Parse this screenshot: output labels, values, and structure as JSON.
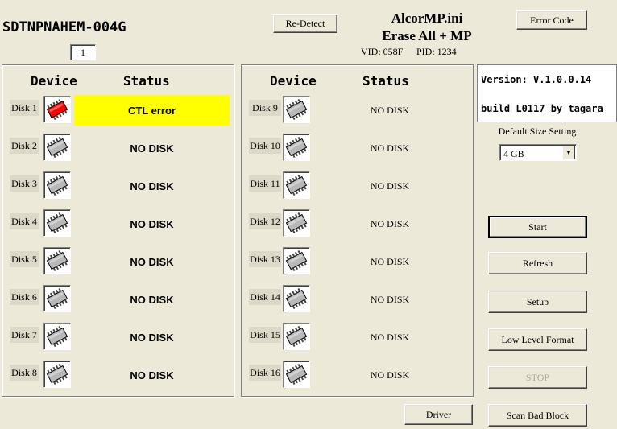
{
  "header": {
    "device_model": "SDTNPNAHEM-004G",
    "count_value": "1",
    "redetect_label": "Re-Detect",
    "ini_name": "AlcorMP.ini",
    "mode": "Erase All + MP",
    "vid": "VID: 058F",
    "pid": "PID: 1234",
    "error_code_label": "Error Code"
  },
  "panels": {
    "device_header": "Device",
    "status_header": "Status"
  },
  "left_disks": [
    {
      "label": "Disk 1",
      "status": "CTL error",
      "state": "error"
    },
    {
      "label": "Disk 2",
      "status": "NO DISK",
      "state": "empty"
    },
    {
      "label": "Disk 3",
      "status": "NO DISK",
      "state": "empty"
    },
    {
      "label": "Disk 4",
      "status": "NO DISK",
      "state": "empty"
    },
    {
      "label": "Disk 5",
      "status": "NO DISK",
      "state": "empty"
    },
    {
      "label": "Disk 6",
      "status": "NO DISK",
      "state": "empty"
    },
    {
      "label": "Disk 7",
      "status": "NO DISK",
      "state": "empty"
    },
    {
      "label": "Disk 8",
      "status": "NO DISK",
      "state": "empty"
    }
  ],
  "right_disks": [
    {
      "label": "Disk 9",
      "status": "NO DISK"
    },
    {
      "label": "Disk 10",
      "status": "NO DISK"
    },
    {
      "label": "Disk 11",
      "status": "NO DISK"
    },
    {
      "label": "Disk 12",
      "status": "NO DISK"
    },
    {
      "label": "Disk 13",
      "status": "NO DISK"
    },
    {
      "label": "Disk 14",
      "status": "NO DISK"
    },
    {
      "label": "Disk 15",
      "status": "NO DISK"
    },
    {
      "label": "Disk 16",
      "status": "NO DISK"
    }
  ],
  "sidebar": {
    "version": "Version: V.1.0.0.14",
    "build": "build L0117 by tagara",
    "default_size_label": "Default Size Setting",
    "default_size_value": "4 GB",
    "buttons": {
      "start": "Start",
      "refresh": "Refresh",
      "setup": "Setup",
      "low_level_format": "Low Level Format",
      "stop": "STOP",
      "scan_bad_block": "Scan Bad Block"
    }
  },
  "footer": {
    "driver_label": "Driver"
  },
  "colors": {
    "error_status_bg": "#ffff00",
    "error_chip": "#ff0000",
    "window_bg": "#ece9d8"
  }
}
